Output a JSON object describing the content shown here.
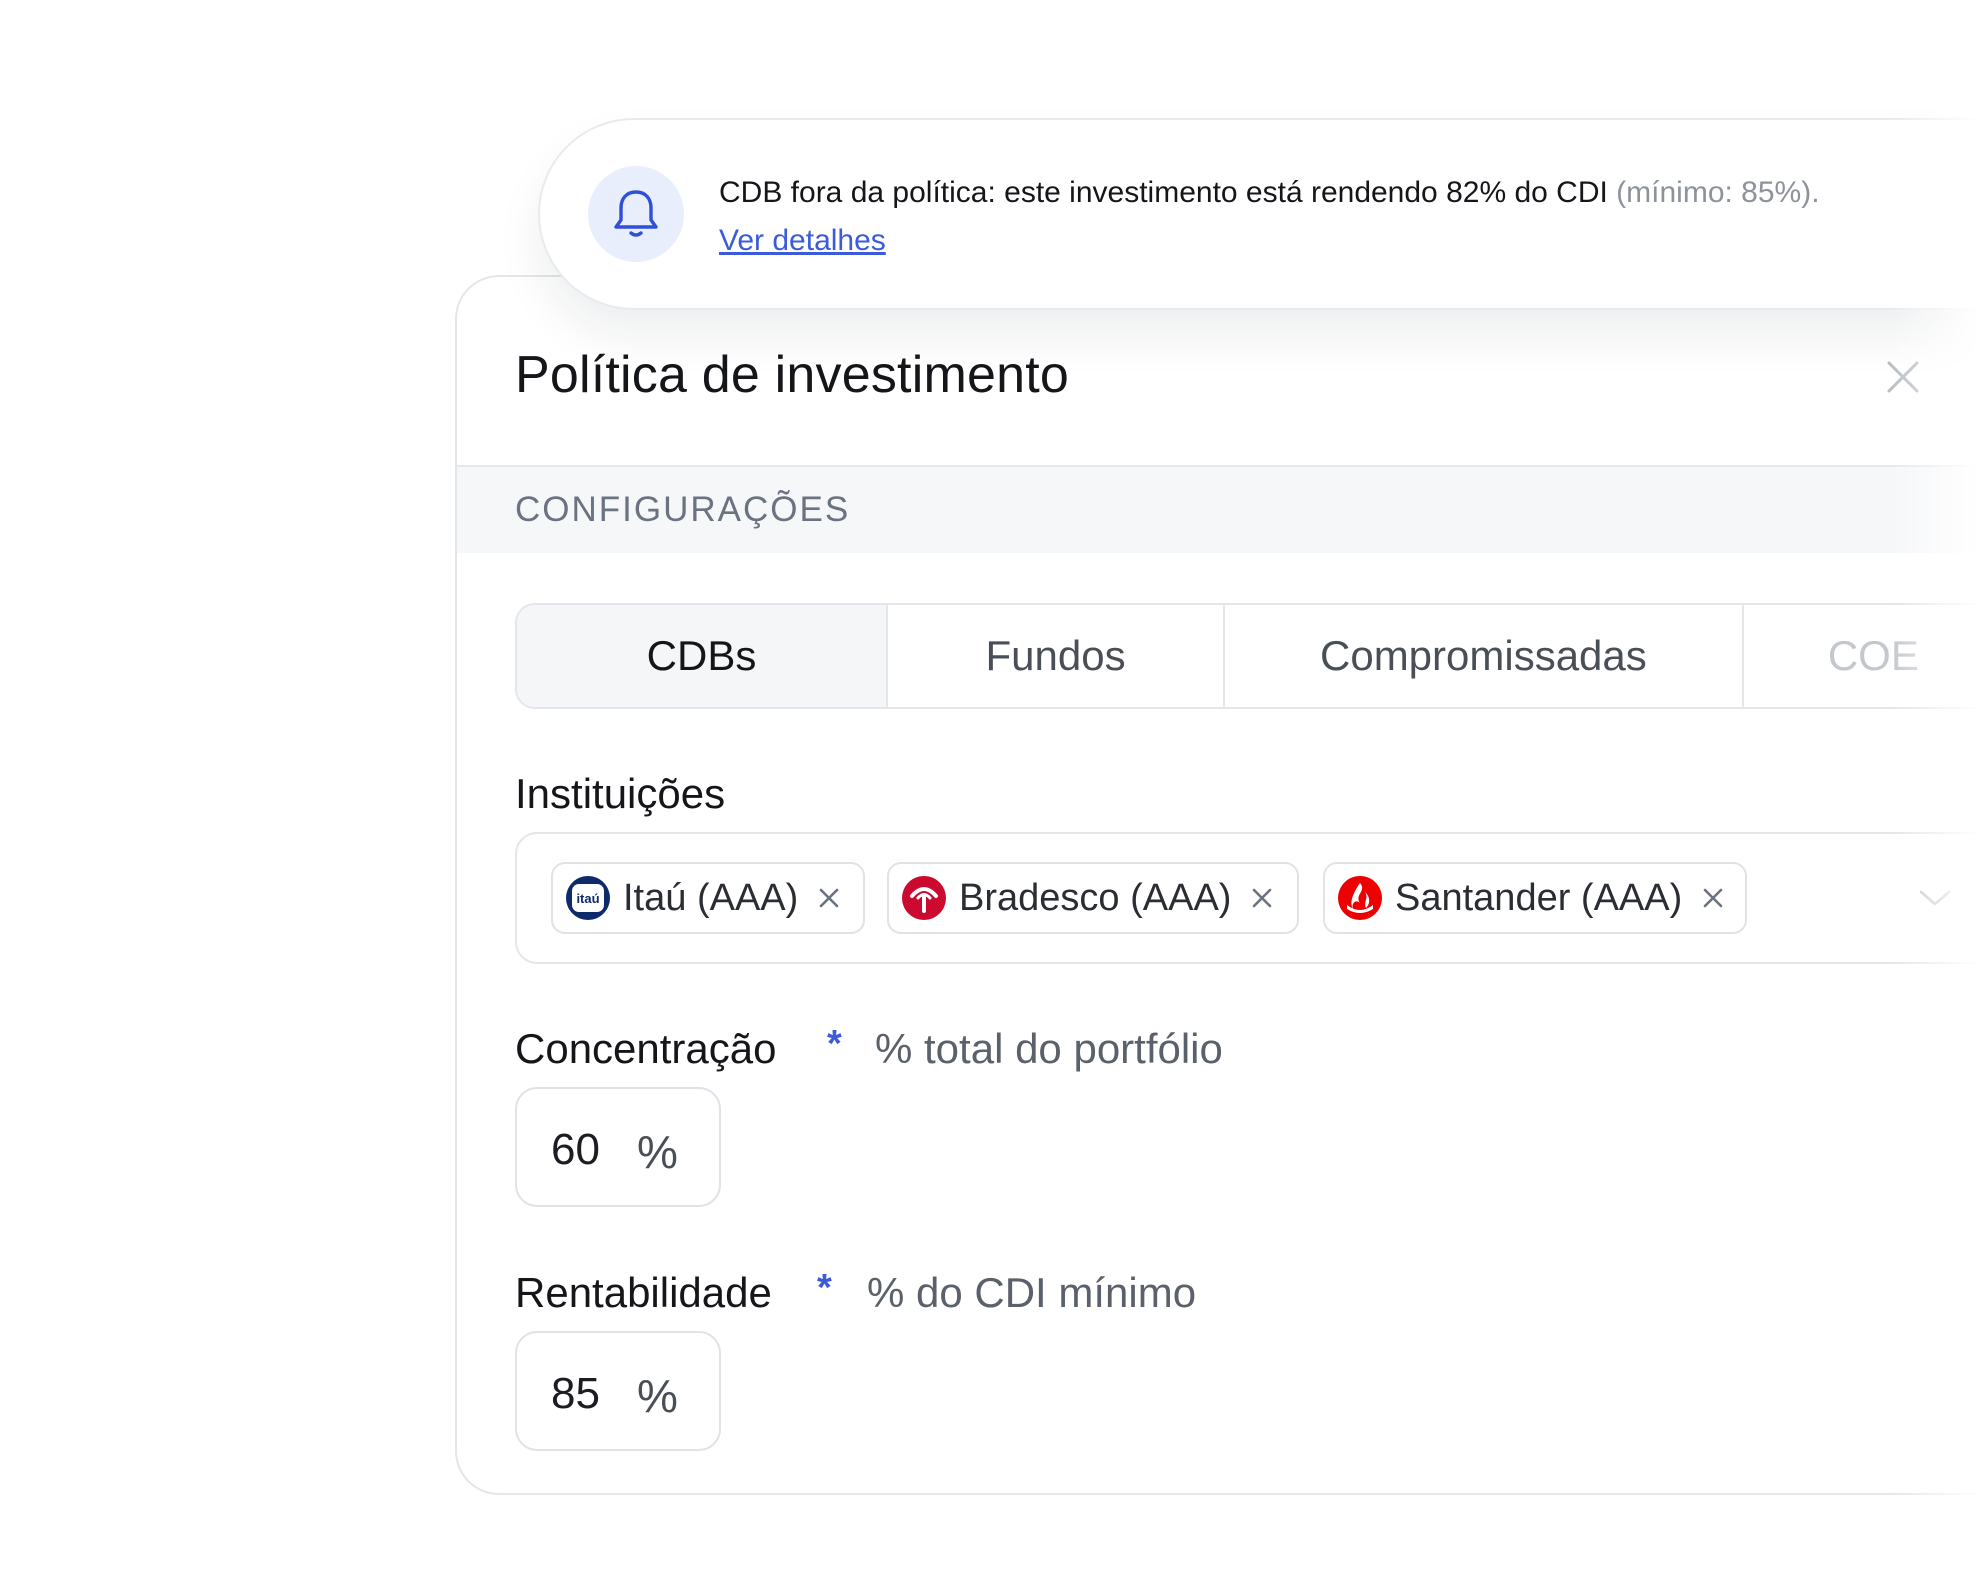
{
  "notification": {
    "icon": "bell-icon",
    "message_main": "CDB fora da política: este investimento está rendendo 82% do CDI",
    "message_muted": " (mínimo: 85%).",
    "link_label": "Ver detalhes"
  },
  "panel": {
    "title": "Política de investimento",
    "section_label": "CONFIGURAÇÕES"
  },
  "tabs": [
    {
      "label": "CDBs",
      "active": true
    },
    {
      "label": "Fundos",
      "active": false
    },
    {
      "label": "Compromissadas",
      "active": false
    },
    {
      "label": "COE",
      "active": false
    }
  ],
  "institutions": {
    "label": "Instituições",
    "chips": [
      {
        "label": "Itaú (AAA)",
        "logo": "itau-logo",
        "logo_text": "itaú",
        "color": "#0d2a6b"
      },
      {
        "label": "Bradesco (AAA)",
        "logo": "bradesco-logo",
        "color": "#cc092f"
      },
      {
        "label": "Santander (AAA)",
        "logo": "santander-logo",
        "color": "#ec0000"
      }
    ]
  },
  "concentration": {
    "label": "Concentração",
    "required_mark": "*",
    "hint": "% total do portfólio",
    "value": "60",
    "unit": "%"
  },
  "profitability": {
    "label": "Rentabilidade",
    "required_mark": "*",
    "hint": "% do CDI mínimo",
    "value": "85",
    "unit": "%"
  },
  "colors": {
    "accent": "#3b5bdb",
    "border": "#e3e6ea",
    "band": "#f6f7f9"
  }
}
